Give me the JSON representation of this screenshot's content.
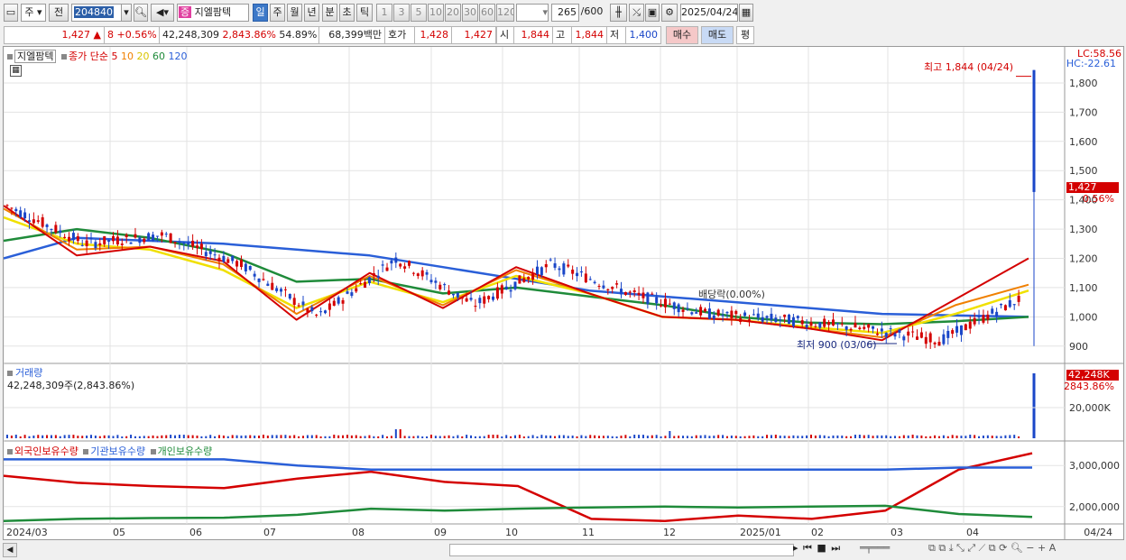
{
  "toolbar": {
    "period_selector": "주",
    "prev_label": "전",
    "code": "204840",
    "stock_badge": "증",
    "stock_name": "지엘팜텍",
    "periods": [
      "일",
      "주",
      "월",
      "년",
      "분",
      "초",
      "틱"
    ],
    "active_period": "일",
    "numbers": [
      "1",
      "3",
      "5",
      "10",
      "20",
      "30",
      "60",
      "120"
    ],
    "count": "265",
    "total": "/600",
    "date": "2025/04/24"
  },
  "quote": {
    "price": "1,427",
    "change": "8",
    "change_pct": "+0.56%",
    "volume": "42,248,309",
    "volume_pct": "2,843.86%",
    "ratio": "54.89%",
    "amount": "68,399백만",
    "ask_label": "호가",
    "ask1": "1,428",
    "bid1": "1,427",
    "open_label": "시",
    "open": "1,844",
    "high_label": "고",
    "high": "1,844",
    "low_label": "저",
    "low": "1,400",
    "buy_label": "매수",
    "sell_label": "매도",
    "flat_label": "평"
  },
  "legend": {
    "name": "지엘팜텍",
    "ma_prefix": "종가 단순",
    "ma": [
      {
        "period": "5",
        "color": "#d40000"
      },
      {
        "period": "10",
        "color": "#f08000"
      },
      {
        "period": "20",
        "color": "#e0d000"
      },
      {
        "period": "60",
        "color": "#1f8b3a"
      },
      {
        "period": "120",
        "color": "#2a5fd8"
      }
    ]
  },
  "corner": {
    "lc": "LC:58.56",
    "hc": "HC:-22.61"
  },
  "annotations": {
    "high": "최고 1,844 (04/24)",
    "low": "최저 900 (03/06)",
    "dividend": "배당락(0.00%)"
  },
  "price_panel": {
    "current_tag": "1,427",
    "current_pct": "0.56%"
  },
  "volume_panel": {
    "title": "거래량",
    "value": "42,248,309주(2,843.86%)",
    "tag": "42,248K",
    "tag_pct": "2843.86%"
  },
  "holdings_panel": {
    "legends": [
      {
        "label": "외국인보유수량",
        "color": "#d40000"
      },
      {
        "label": "기관보유수량",
        "color": "#2a5fd8"
      },
      {
        "label": "개인보유수량",
        "color": "#1f8b3a"
      }
    ]
  },
  "x_axis": {
    "labels": [
      "2024/03",
      "05",
      "06",
      "07",
      "08",
      "09",
      "10",
      "11",
      "12",
      "2025/01",
      "02",
      "03",
      "04"
    ],
    "right_label": "04/24"
  },
  "chart_data": [
    {
      "type": "candlestick",
      "title": "지엘팜텍",
      "ylim": [
        850,
        1880
      ],
      "y_ticks": [
        900,
        1000,
        1100,
        1200,
        1300,
        1400,
        1500,
        1600,
        1700,
        1800
      ],
      "y_tick_labels": [
        "900",
        "1,000",
        "1,100",
        "1,200",
        "1,300",
        "1,400",
        "1,500",
        "1,600",
        "1,700",
        "1,800"
      ],
      "x_months": [
        "2024/03",
        "05",
        "06",
        "07",
        "08",
        "09",
        "10",
        "11",
        "12",
        "2025/01",
        "02",
        "03",
        "04"
      ],
      "close_path": [
        [
          "2024/03",
          1380
        ],
        [
          "2024/04",
          1250
        ],
        [
          "2024/05",
          1280
        ],
        [
          "2024/06",
          1180
        ],
        [
          "2024/07",
          1000
        ],
        [
          "2024/08",
          1200
        ],
        [
          "2024/09",
          1040
        ],
        [
          "2024/10",
          1180
        ],
        [
          "2024/11",
          1080
        ],
        [
          "2024/12",
          1010
        ],
        [
          "2025/01",
          990
        ],
        [
          "2025/02",
          960
        ],
        [
          "2025/03",
          920
        ],
        [
          "2025/04",
          1060
        ],
        [
          "2025/04/24",
          1427
        ]
      ],
      "series": [
        {
          "name": "5",
          "values": [
            1380,
            1210,
            1240,
            1190,
            990,
            1150,
            1030,
            1170,
            1080,
            1000,
            990,
            960,
            920,
            1060,
            1200
          ]
        },
        {
          "name": "10",
          "values": [
            1370,
            1230,
            1240,
            1180,
            1010,
            1140,
            1040,
            1160,
            1080,
            1000,
            990,
            960,
            930,
            1040,
            1110
          ]
        },
        {
          "name": "20",
          "values": [
            1340,
            1250,
            1230,
            1160,
            1030,
            1120,
            1050,
            1140,
            1080,
            1000,
            990,
            965,
            945,
            1010,
            1090
          ]
        },
        {
          "name": "60",
          "values": [
            1260,
            1300,
            1270,
            1220,
            1120,
            1130,
            1080,
            1100,
            1070,
            1040,
            1000,
            980,
            975,
            985,
            1000
          ]
        },
        {
          "name": "120",
          "values": [
            1200,
            1270,
            1260,
            1250,
            1230,
            1210,
            1170,
            1130,
            1090,
            1070,
            1050,
            1030,
            1010,
            1005,
            1000
          ]
        }
      ],
      "high": 1844,
      "low": 900,
      "last": 1427
    },
    {
      "type": "bar",
      "title": "거래량",
      "y_tick_labels": [
        "20,000K"
      ],
      "ylim": [
        0,
        45000000
      ],
      "values_note_last": 42248309
    },
    {
      "type": "line",
      "y_tick_labels": [
        "2,000,000",
        "3,000,000"
      ],
      "ylim": [
        1600000,
        3400000
      ],
      "series": [
        {
          "name": "외국인보유수량",
          "values": [
            2750000,
            2580000,
            2500000,
            2450000,
            2680000,
            2850000,
            2600000,
            2500000,
            1700000,
            1650000,
            1780000,
            1700000,
            1900000,
            2900000,
            3300000
          ]
        },
        {
          "name": "기관보유수량",
          "values": [
            3150000,
            3150000,
            3150000,
            3150000,
            3000000,
            2900000,
            2900000,
            2900000,
            2900000,
            2900000,
            2900000,
            2900000,
            2900000,
            2950000,
            2950000
          ]
        },
        {
          "name": "개인보유수량",
          "values": [
            1650000,
            1700000,
            1720000,
            1730000,
            1800000,
            1950000,
            1900000,
            1950000,
            1980000,
            2000000,
            1980000,
            2000000,
            2020000,
            1820000,
            1750000
          ]
        }
      ]
    }
  ]
}
